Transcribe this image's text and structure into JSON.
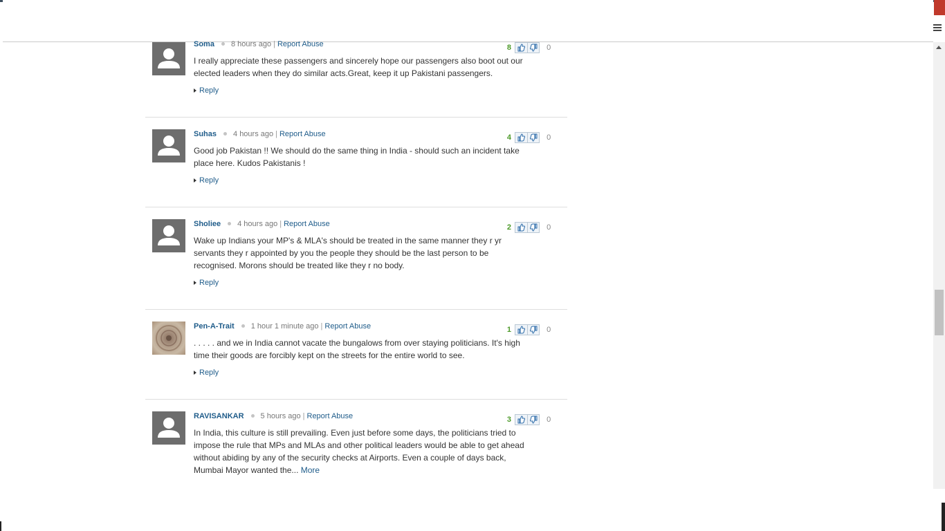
{
  "comments": [
    {
      "author": "Soma",
      "time": "8 hours ago",
      "report": "Report Abuse",
      "up": "8",
      "down": "0",
      "lines": [
        "I really appreciate these passengers and sincerely hope our passengers also boot out our",
        "elected leaders when they do similar acts.Great, keep it up Pakistani passengers."
      ],
      "reply": "Reply"
    },
    {
      "author": "Suhas",
      "time": "4 hours ago",
      "report": "Report Abuse",
      "up": "4",
      "down": "0",
      "lines": [
        "Good job Pakistan !! We should do the same thing in India - should such an incident take",
        "place here. Kudos Pakistanis !"
      ],
      "reply": "Reply"
    },
    {
      "author": "Sholiee",
      "time": "4 hours ago",
      "report": "Report Abuse",
      "up": "2",
      "down": "0",
      "lines": [
        "Wake up Indians your MP's & MLA's should be treated in the same manner they r yr",
        "servants they r appointed by you the people they should be the last person to be",
        "recognised. Morons should be treated like they r no body."
      ],
      "reply": "Reply"
    },
    {
      "author": "Pen-A-Trait",
      "time": "1 hour 1 minute ago",
      "report": "Report Abuse",
      "up": "1",
      "down": "0",
      "lines": [
        ". . . . . and we in India cannot vacate the bungalows from over staying politicians. It's high",
        "time their goods are forcibly kept on the streets for the entire world to see."
      ],
      "reply": "Reply"
    },
    {
      "author": "RAVISANKAR",
      "time": "5 hours ago",
      "report": "Report Abuse",
      "up": "3",
      "down": "0",
      "lines": [
        "In India, this culture is still prevailing. Even just before some days, the politicians tried to",
        "impose the rule that MPs and MLAs and other political leaders would be able to get ahead",
        "without abiding by any of the security checks at Airports. Even a couple of days back,",
        "Mumbai Mayor wanted the..."
      ],
      "more": "More"
    }
  ]
}
